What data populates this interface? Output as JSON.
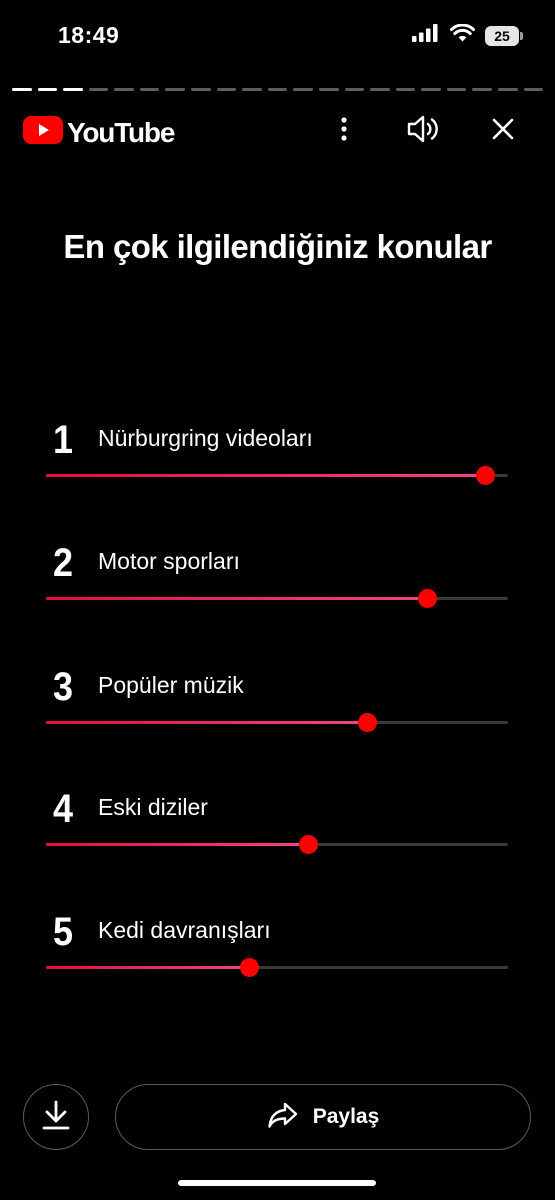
{
  "status_bar": {
    "time": "18:49",
    "battery": "25",
    "icons": [
      "cellular-signal-icon",
      "wifi-icon",
      "battery-icon"
    ]
  },
  "story_progress": {
    "segments_total": 21,
    "segments_done": 3
  },
  "header": {
    "logo_text": "YouTube",
    "icons": [
      "youtube-play-icon",
      "more-vertical-icon",
      "volume-icon",
      "close-icon"
    ],
    "brand_color": "#FF0000"
  },
  "title": "En çok ilgilendiğiniz konular",
  "topics": [
    {
      "rank": "1",
      "label": "Nürburgring videoları",
      "level": 0.95
    },
    {
      "rank": "2",
      "label": "Motor sporları",
      "level": 0.825
    },
    {
      "rank": "3",
      "label": "Popüler müzik",
      "level": 0.695
    },
    {
      "rank": "4",
      "label": "Eski diziler",
      "level": 0.567
    },
    {
      "rank": "5",
      "label": "Kedi davranışları",
      "level": 0.44
    }
  ],
  "footer": {
    "download_icon": "download-icon",
    "share_icon": "share-arrow-icon",
    "share_label": "Paylaş"
  },
  "colors": {
    "background": "#000000",
    "accent": "#FF0000",
    "fill_start": "#E30F3C",
    "fill_end": "#F3428A"
  }
}
